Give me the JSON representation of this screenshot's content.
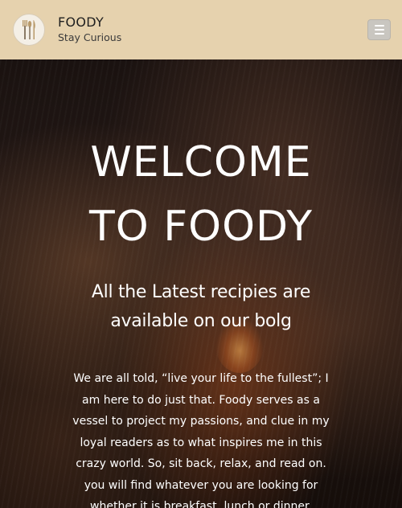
{
  "navbar": {
    "logo_icon": "cutlery-icon",
    "brand_name": "FOODY",
    "tagline": "Stay Curious",
    "menu_icon": "hamburger-menu-icon"
  },
  "hero": {
    "title_line1": "WELCOME",
    "title_line2": "TO FOODY",
    "subtitle": "All the Latest recipies are available on our bolg",
    "description": "We are all told, “live your life to the fullest”; I am here to do just that. Foody serves as a vessel to project my passions, and clue in my loyal readers as to what inspires me in this crazy world. So, sit back, relax, and read on. you will find whatever you are looking for whether it is breakfast, lunch or dinner."
  },
  "colors": {
    "navbar_bg": "#e6d2ae",
    "hero_text": "#ffffff",
    "menu_button_bg": "#c9c6c0"
  }
}
